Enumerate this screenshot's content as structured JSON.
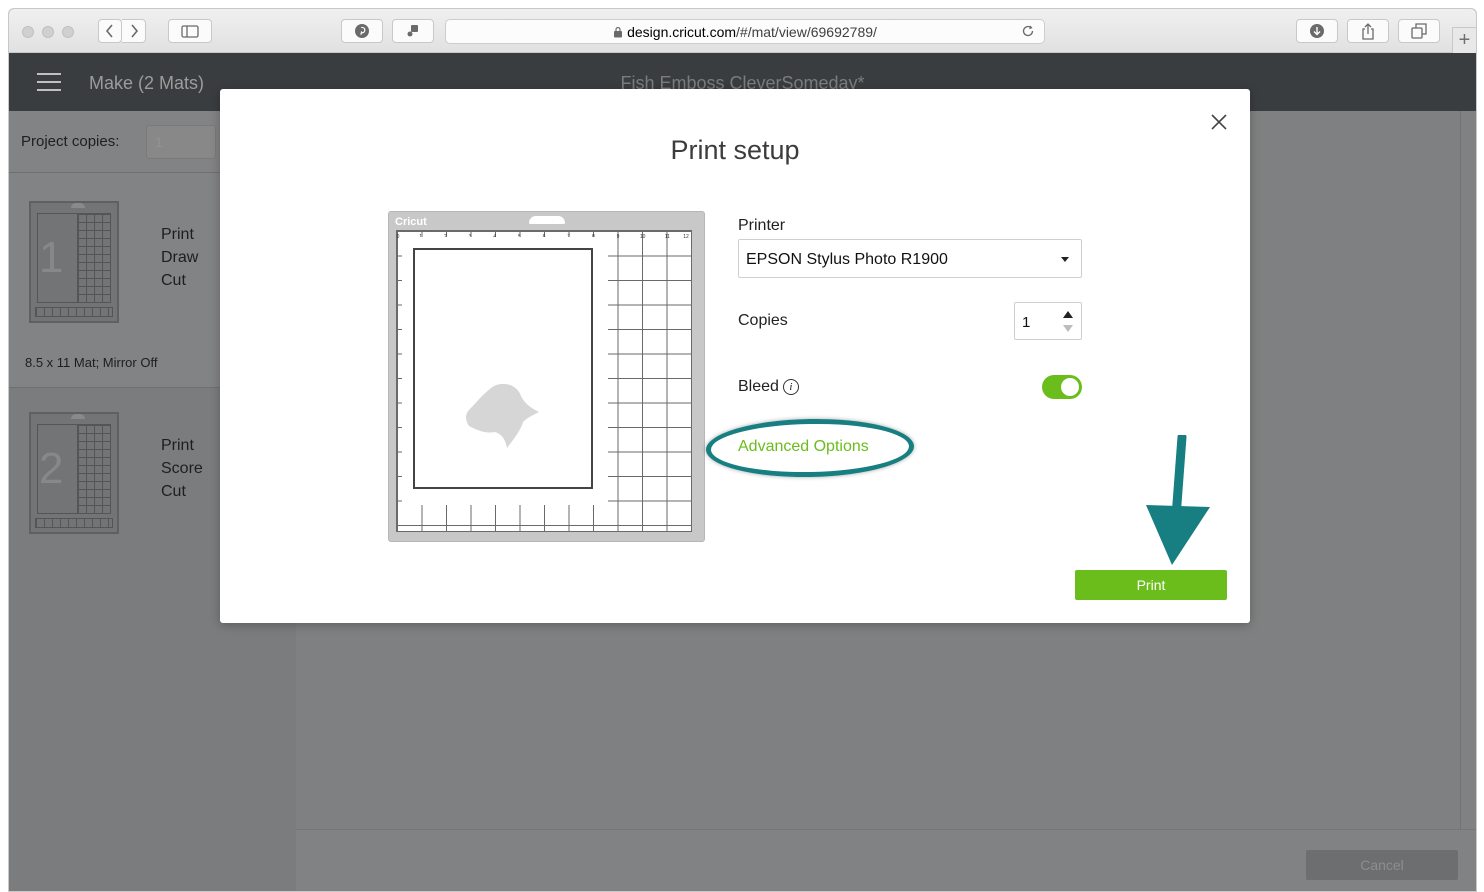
{
  "browser": {
    "url_host": "design.cricut.com",
    "url_path": "/#/mat/view/69692789/",
    "new_tab_label": "+"
  },
  "app": {
    "menu_label": "Make (2 Mats)",
    "project_title": "Fish Emboss CleverSomeday*"
  },
  "sidebar": {
    "project_copies_label": "Project copies:",
    "project_copies_value": "1",
    "mats": [
      {
        "number": "1",
        "steps": [
          "Print",
          "Draw",
          "Cut"
        ],
        "caption": "8.5 x 11 Mat; Mirror Off"
      },
      {
        "number": "2",
        "steps": [
          "Print",
          "Score",
          "Cut"
        ],
        "caption": ""
      }
    ]
  },
  "footer": {
    "cancel_label": "Cancel"
  },
  "dialog": {
    "title": "Print setup",
    "preview_brand": "Cricut",
    "printer_label": "Printer",
    "printer_value": "EPSON Stylus Photo R1900",
    "copies_label": "Copies",
    "copies_value": "1",
    "bleed_label": "Bleed",
    "bleed_info_glyph": "i",
    "bleed_on": true,
    "advanced_options_label": "Advanced Options",
    "print_label": "Print",
    "ruler_ticks": [
      "0",
      "1",
      "2",
      "3",
      "4",
      "5",
      "6",
      "7",
      "8",
      "9",
      "10",
      "11",
      "12"
    ]
  },
  "colors": {
    "accent_green": "#6bbd1b",
    "annotation_teal": "#177e82",
    "appbar": "#3a3d40",
    "overlay_gray": "#7f8081"
  },
  "icons": [
    "back-icon",
    "forward-icon",
    "sidebar-icon",
    "pinterest-icon",
    "extension-icon",
    "lock-icon",
    "reload-icon",
    "download-icon",
    "share-icon",
    "tabs-icon",
    "hamburger-icon",
    "close-icon",
    "info-icon",
    "fish-icon",
    "arrow-annotation-icon"
  ]
}
